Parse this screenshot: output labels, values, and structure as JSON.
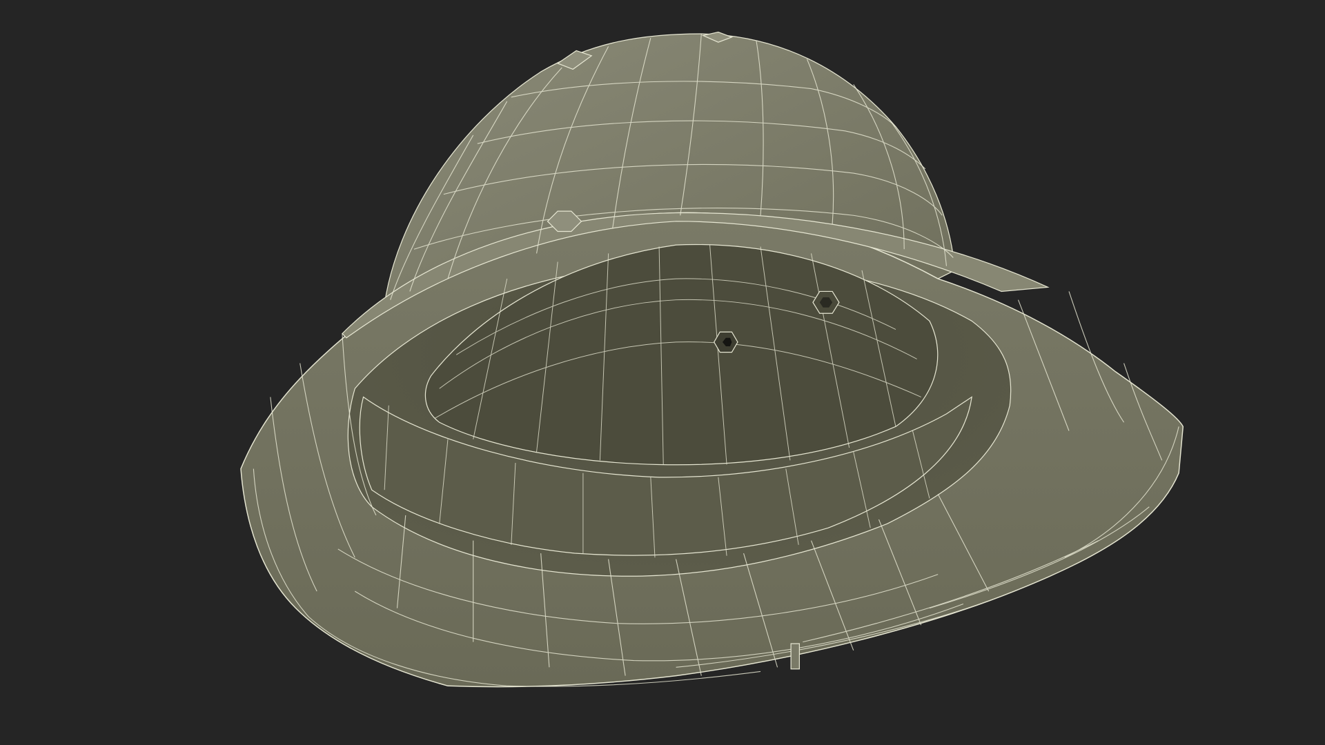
{
  "scene": {
    "background_color": "#252525",
    "subject": "helmet-wireframe",
    "colors": {
      "shell": "#7d7d6b",
      "shell_shadow": "#63634f",
      "interior": "#545443",
      "interior_deep": "#4a4a3a",
      "wire": "#e6e6d2"
    }
  }
}
